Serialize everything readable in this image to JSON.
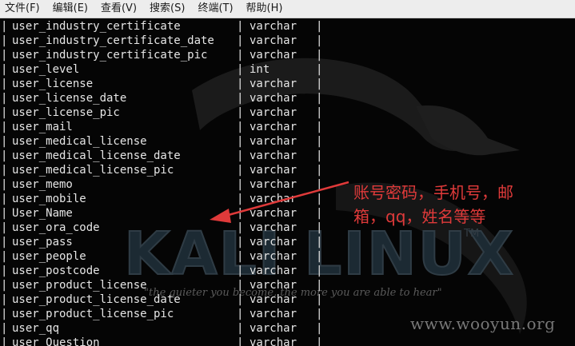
{
  "menubar": {
    "items": [
      "文件(F)",
      "编辑(E)",
      "查看(V)",
      "搜索(S)",
      "终端(T)",
      "帮助(H)"
    ]
  },
  "terminal": {
    "rows": [
      {
        "name": "user_industry_certificate",
        "type": "varchar"
      },
      {
        "name": "user_industry_certificate_date",
        "type": "varchar"
      },
      {
        "name": "user_industry_certificate_pic",
        "type": "varchar"
      },
      {
        "name": "user_level",
        "type": "int"
      },
      {
        "name": "user_license",
        "type": "varchar"
      },
      {
        "name": "user_license_date",
        "type": "varchar"
      },
      {
        "name": "user_license_pic",
        "type": "varchar"
      },
      {
        "name": "user_mail",
        "type": "varchar"
      },
      {
        "name": "user_medical_license",
        "type": "varchar"
      },
      {
        "name": "user_medical_license_date",
        "type": "varchar"
      },
      {
        "name": "user_medical_license_pic",
        "type": "varchar"
      },
      {
        "name": "user_memo",
        "type": "varchar"
      },
      {
        "name": "user_mobile",
        "type": "varchar"
      },
      {
        "name": "User_Name",
        "type": "varchar"
      },
      {
        "name": "user_ora_code",
        "type": "varchar"
      },
      {
        "name": "user_pass",
        "type": "varchar"
      },
      {
        "name": "user_people",
        "type": "varchar"
      },
      {
        "name": "user_postcode",
        "type": "varchar"
      },
      {
        "name": "user_product_license",
        "type": "varchar"
      },
      {
        "name": "user_product_license_date",
        "type": "varchar"
      },
      {
        "name": "user_product_license_pic",
        "type": "varchar"
      },
      {
        "name": "user_qq",
        "type": "varchar"
      },
      {
        "name": "user_Question",
        "type": "varchar"
      }
    ],
    "pipe": "|"
  },
  "annotation": {
    "line1": "账号密码，手机号，邮",
    "line2": "箱，qq，姓名等等",
    "color": "#e03a3a"
  },
  "background": {
    "logo_text": "KALI LINUX",
    "trademark": "TM",
    "slogan": "\"the quieter you become, the more you are able to hear\"",
    "watermark": "www.wooyun.org"
  }
}
